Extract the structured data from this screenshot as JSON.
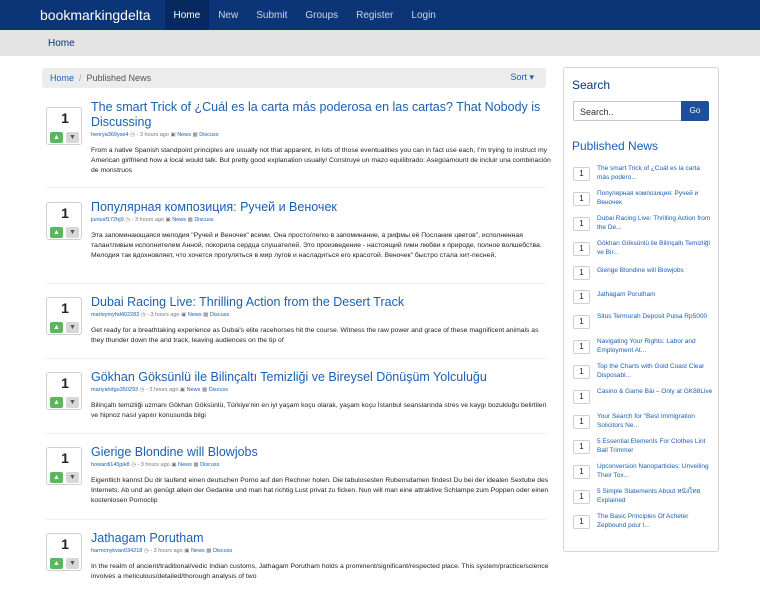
{
  "nav": {
    "brand": "bookmarkingdelta",
    "items": [
      "Home",
      "New",
      "Submit",
      "Groups",
      "Register",
      "Login"
    ],
    "active": "Home"
  },
  "subnav": {
    "label": "Home"
  },
  "breadcrumb": {
    "home": "Home",
    "separator": "/",
    "current": "Published News",
    "sort": "Sort ▾"
  },
  "stories": [
    {
      "votes": "1",
      "title": "The smart Trick of ¿Cuál es la carta más poderosa en las cartas? That Nobody is Discussing",
      "author": "henrya369yse4",
      "time": "- 3 hours ago",
      "category": "News",
      "discuss": "Discuss",
      "body": "From a native Spanish standpoint principles are usually not that apparent, in lots of those eventualities you can in fact use each, I’m trying to instruct my American girlfriend how a local would talk. But pretty good explanation usually! Construye un mazo equilibrado: Asegúamount de incluir una combinación de monstruos"
    },
    {
      "votes": "1",
      "title": "Популярная композиция: Ручей и Веночек",
      "author": "juniusf172trj9",
      "time": "- 3 hours ago",
      "category": "News",
      "discuss": "Discuss",
      "body": "Эта запоминающаяся мелодия \"Ручей и Веночек\" всеми. Она просто/легко в запоминание, а рифмы её Послание цветов\", исполненная талантливым исполнителем Анной, покорила сердца слушателей. Это произведение - настоящий гимн любви к природе, полное волшебства. Мелодия так вдохновляет, что хочется прогуляться в мир лугов и насладиться его красотой. Веночек\" быстро стала хит-песней,"
    },
    {
      "votes": "1",
      "title": "Dubai Racing Live: Thrilling Action from the Desert Track",
      "author": "marleymyhd402282",
      "time": "- 3 hours ago",
      "category": "News",
      "discuss": "Discuss",
      "body": "Get ready for a breathtaking experience as Dubai's elite racehorses hit the course. Witness the raw power and grace of these magnificent animals as they thunder down the arid track, leaving audiences on the tip of"
    },
    {
      "votes": "1",
      "title": "Gökhan Göksünlü ile Bilinçaltı Temizliği ve Bireysel Dönüşüm Yolculuğu",
      "author": "mariyahdgu350293",
      "time": "- 3 hours ago",
      "category": "News",
      "discuss": "Discuss",
      "body": "Bilinçaltı temizliği uzmanı Gökhan Göksünlü, Türkiye'nin en iyi yaşam koçu olarak, yaşam koçu İstanbul seanslarında stres ve kaygı bozukluğu belirtileri ve hipnoz nasıl yapılır konusunda bilgi"
    },
    {
      "votes": "1",
      "title": "Gierige Blondine will Blowjobs",
      "author": "howardi145jpk8",
      "time": "- 3 hours ago",
      "category": "News",
      "discuss": "Discuss",
      "body": "Eigentlich kannst Du dir laufend einen deutschen Porno auf den Rechner holen. Die tabulosesten Rubensdamen findest Du bei der idealen Sextube des Internets. Ab und an genügt allein der Gedanke und man hat richtig Lust privat zu ficken. Nun will man eine attraktive Schlampe zum Poppen oder einen kostenlosen Pornoclip"
    },
    {
      "votes": "1",
      "title": "Jathagam Porutham",
      "author": "harmonykvan034218",
      "time": "- 3 hours ago",
      "category": "News",
      "discuss": "Discuss",
      "body": "In the realm of ancient/traditional/vedic Indian customs, Jathagam Porutham holds a prominent/significant/respected place. This system/practice/science involves a meticulous/detailed/thorough analysis of two"
    }
  ],
  "sidebar": {
    "search_title": "Search",
    "search_placeholder": "Search..",
    "search_button": "Go",
    "published_title": "Published News",
    "items": [
      {
        "votes": "1",
        "title": "The smart Trick of ¿Cuál es la carta más podero..."
      },
      {
        "votes": "1",
        "title": "Популярная композиция: Ручей и Веночек"
      },
      {
        "votes": "1",
        "title": "Dubai Racing Live: Thrilling Action from the De..."
      },
      {
        "votes": "1",
        "title": "Gökhan Göksünlü ile Bilinçaltı Temizliği ve Bir..."
      },
      {
        "votes": "1",
        "title": "Gierige Blondine will Blowjobs"
      },
      {
        "votes": "1",
        "title": "Jathagam Porutham"
      },
      {
        "votes": "1",
        "title": "Situs Termurah Deposit Pulsa Rp5000"
      },
      {
        "votes": "1",
        "title": "Navigating Your Rights: Labor and Employment At..."
      },
      {
        "votes": "1",
        "title": "Top the Charts with Gold Coast Clear Disposabl..."
      },
      {
        "votes": "1",
        "title": "Casino & Game Bài – Only at GK88Live"
      },
      {
        "votes": "1",
        "title": "Your Search for \"Best Immigration Solicitors Ne..."
      },
      {
        "votes": "1",
        "title": "5 Essential Elements For Clothes Lint Ball Trimmer"
      },
      {
        "votes": "1",
        "title": "Upconversion Nanoparticles: Unveiling Their Tox..."
      },
      {
        "votes": "1",
        "title": "5 Simple Statements About หนังไทย Explained"
      },
      {
        "votes": "1",
        "title": "The Basic Principles Of Acheter Zepbound pour l..."
      }
    ]
  },
  "colors": {
    "navbar": "#0b3577",
    "link": "#1a5fb4",
    "upvote": "#5bb75b",
    "search_button": "#1d4f9a"
  },
  "icons": {
    "upvote": "thumbs-up-icon",
    "downvote": "thumbs-down-icon",
    "time": "clock-icon",
    "category": "folder-icon",
    "discuss": "comment-icon"
  }
}
